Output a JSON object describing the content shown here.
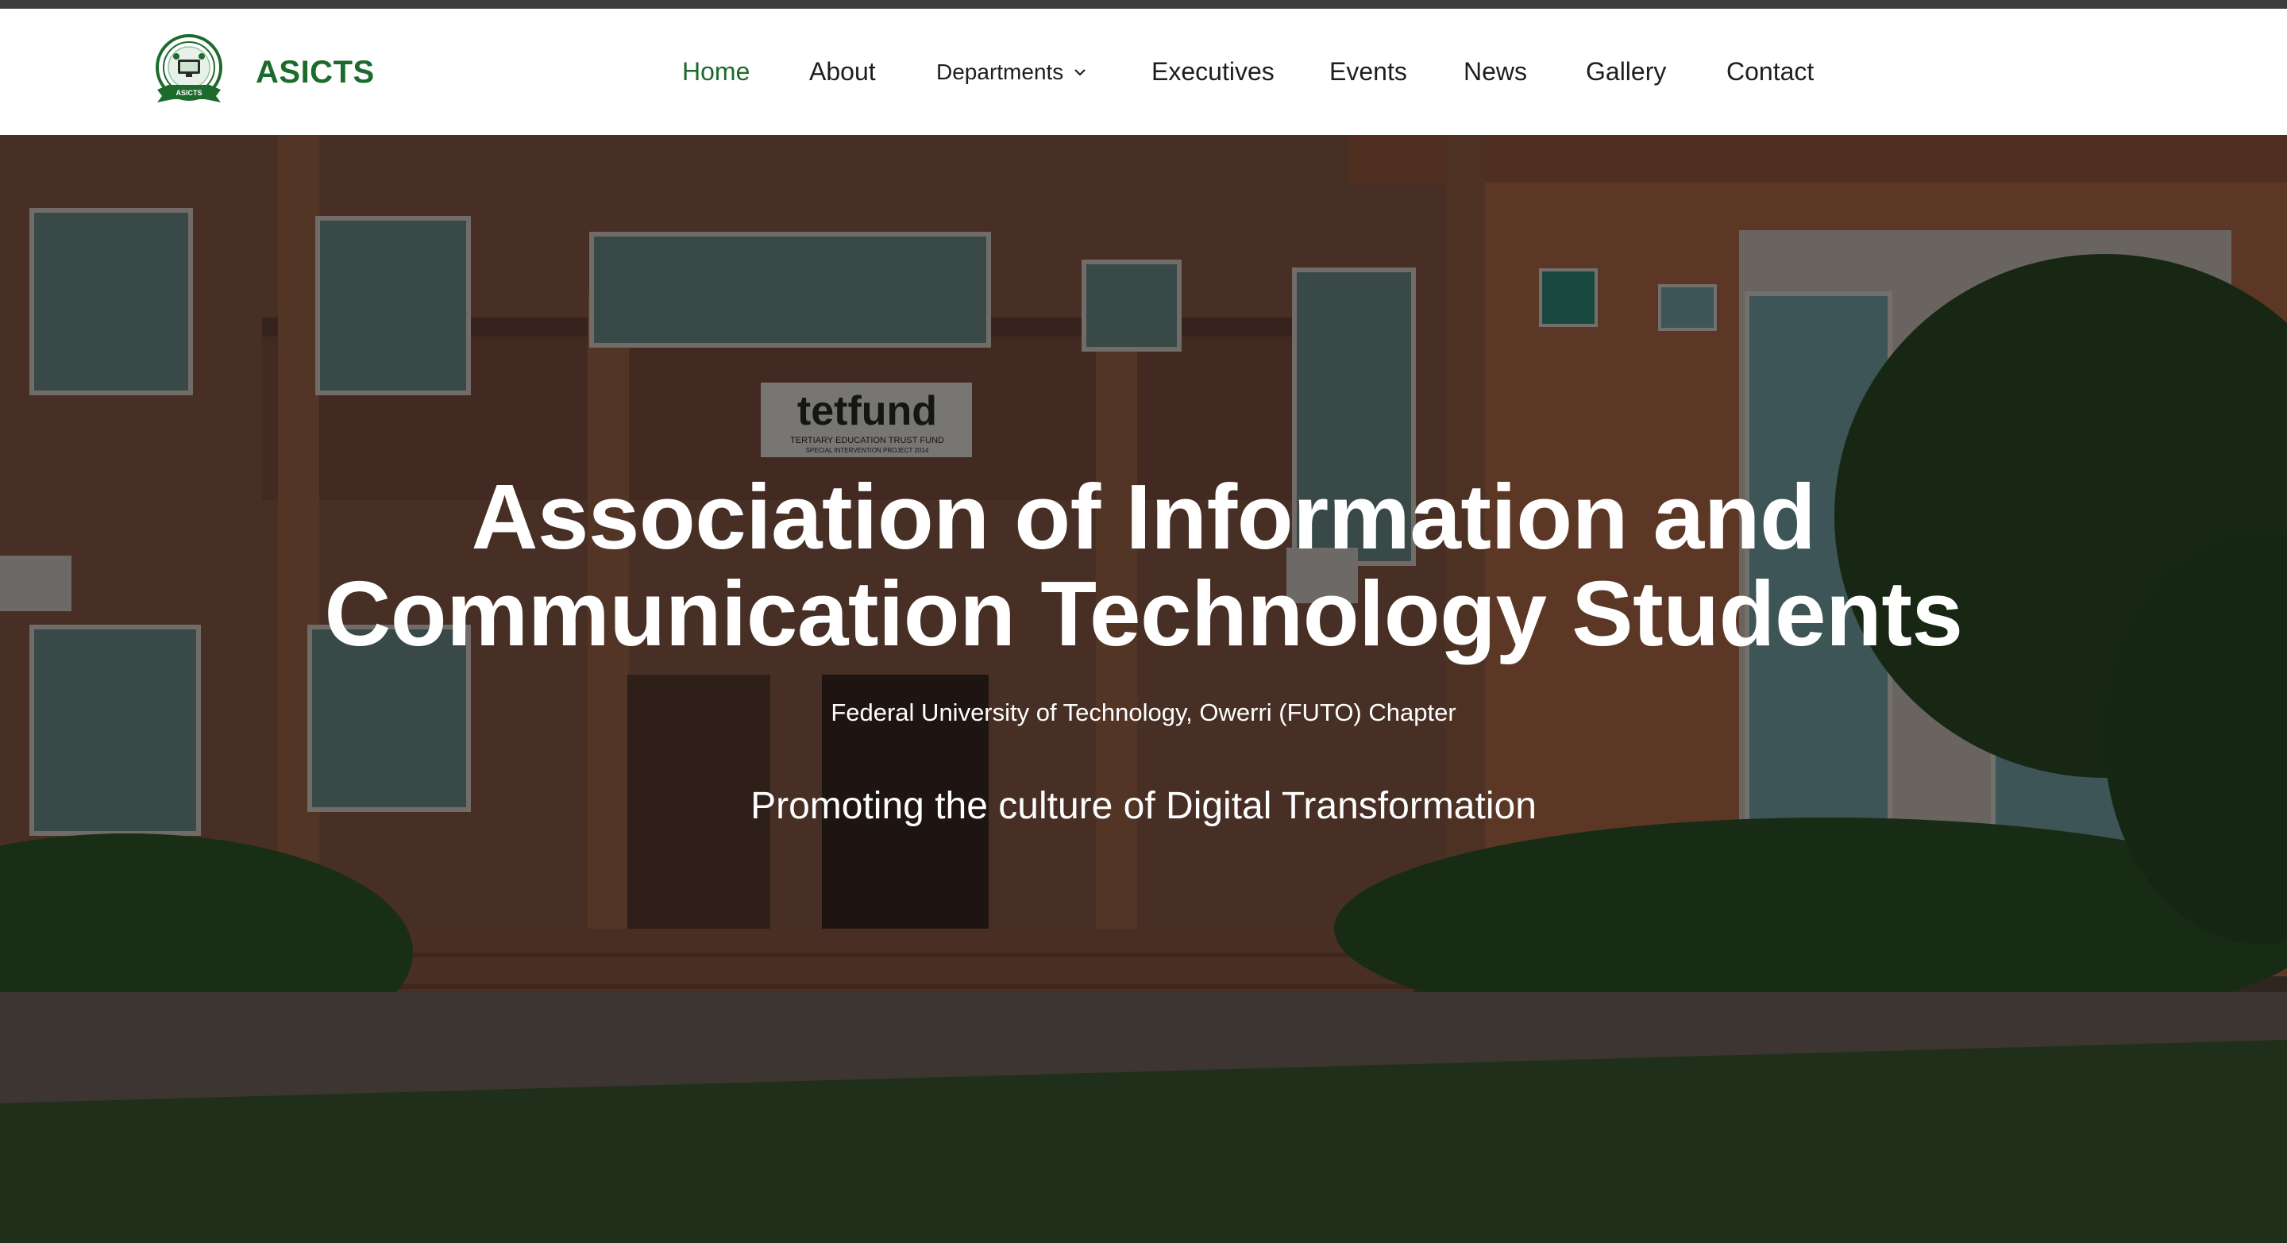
{
  "brand": {
    "name": "ASICTS",
    "logo_icon": "asicts-crest-logo",
    "logo_ribbon_text": "ASICTS",
    "color": "#1d6b2c"
  },
  "nav": {
    "items": [
      {
        "label": "Home",
        "active": true
      },
      {
        "label": "About"
      },
      {
        "label": "Departments",
        "has_dropdown": true
      },
      {
        "label": "Executives"
      },
      {
        "label": "Events"
      },
      {
        "label": "News"
      },
      {
        "label": "Gallery"
      },
      {
        "label": "Contact"
      }
    ]
  },
  "hero": {
    "title_line1": "Association of Information and",
    "title_line2": "Communication Technology Students",
    "subtitle": "Federal University of Technology, Owerri (FUTO) Chapter",
    "tagline": "Promoting the culture of Digital Transformation",
    "building_sign_line1": "tetfund",
    "building_sign_line2": "TERTIARY EDUCATION TRUST FUND",
    "building_sign_line3": "SPECIAL INTERVENTION PROJECT 2014"
  },
  "colors": {
    "accent": "#1d6b2c",
    "topbar": "#3d3d3d",
    "header_bg": "#ffffff",
    "hero_text": "#ffffff"
  }
}
